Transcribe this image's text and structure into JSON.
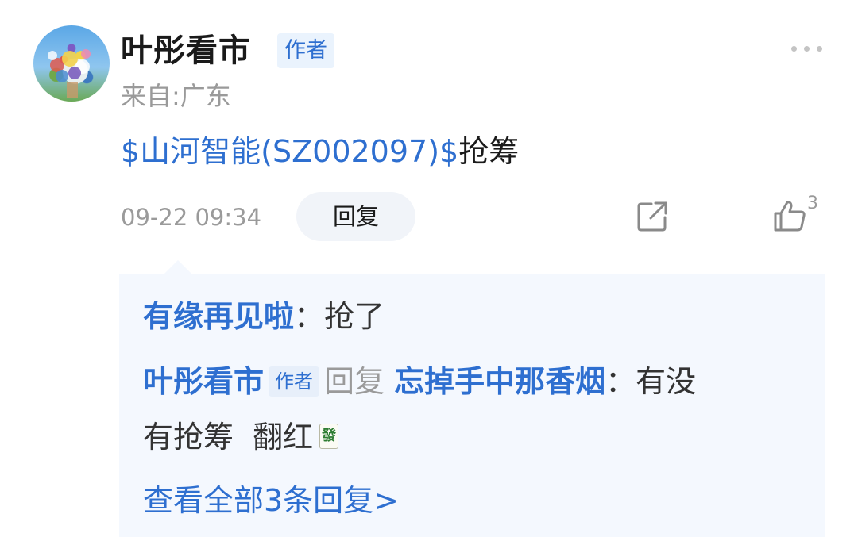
{
  "post": {
    "author": {
      "name": "叶彤看市",
      "badge": "作者",
      "location": "来自:广东"
    },
    "body": {
      "stock_tag": "$山河智能(SZ002097)$",
      "text": "抢筹"
    },
    "timestamp": "09-22 09:34",
    "reply_label": "回复",
    "like_count": "3",
    "icons": {
      "avatar": "avatar-image",
      "more": "more-dots-icon",
      "share": "share-icon",
      "like": "thumb-up-icon"
    }
  },
  "replies": {
    "items": [
      {
        "user": "有缘再见啦",
        "colon": "：",
        "content": "抢了"
      },
      {
        "user": "叶彤看市",
        "badge": "作者",
        "verb": "回复",
        "target": "忘掉手中那香烟",
        "colon": "：",
        "content_line1": "有没",
        "content_line2": "有抢筹  翻红",
        "emoji": "發"
      }
    ],
    "view_all": "查看全部3条回复>"
  },
  "colors": {
    "link_blue": "#2e6fd0",
    "muted_gray": "#9a9a9a",
    "panel_bg": "#f4f8fe"
  }
}
